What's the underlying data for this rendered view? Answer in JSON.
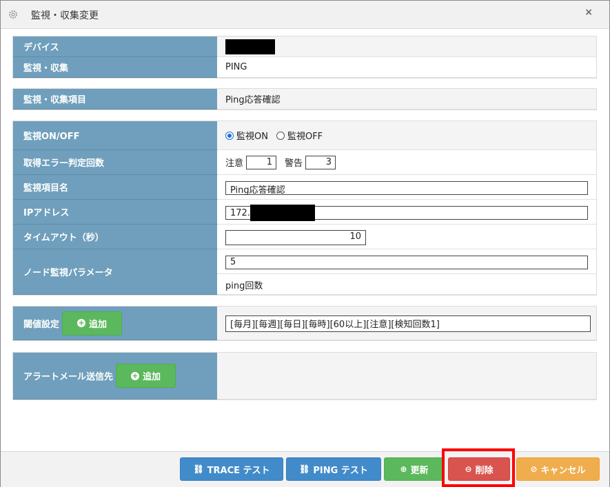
{
  "dialog": {
    "title": "監視・収集変更",
    "close_label": "×",
    "title_icon": "gear-icon"
  },
  "section1": {
    "device_label": "デバイス",
    "device_value": "",
    "monitor_label": "監視・収集",
    "monitor_value": "PING"
  },
  "section2": {
    "item_label": "監視・収集項目",
    "item_value": "Ping応答確認"
  },
  "section3": {
    "onoff_label": "監視ON/OFF",
    "on_label": "監視ON",
    "off_label": "監視OFF",
    "on_selected": true,
    "error_label": "取得エラー判定回数",
    "caution_label": "注意",
    "caution_value": "1",
    "warning_label": "警告",
    "warning_value": "3",
    "name_label": "監視項目名",
    "name_value": "Ping応答確認",
    "ip_label": "IPアドレス",
    "ip_value": "172.",
    "timeout_label": "タイムアウト（秒）",
    "timeout_value": "10",
    "node_label": "ノード監視パラメータ",
    "node_value": "5",
    "node_hint": "ping回数"
  },
  "section4": {
    "threshold_label": "閾値設定",
    "add_label": "追加",
    "threshold_value": "[毎月][毎週][毎日][毎時][60以上][注意][検知回数1]"
  },
  "section5": {
    "alert_label": "アラートメール送信先",
    "add_label": "追加"
  },
  "footer": {
    "trace_label": "TRACE テスト",
    "ping_label": "PING テスト",
    "update_label": "更新",
    "delete_label": "削除",
    "cancel_label": "キャンセル"
  },
  "colors": {
    "label_bg": "#6f9fbc",
    "button_blue": "#428bca",
    "button_green": "#5cb85c",
    "button_red": "#d9534f",
    "button_orange": "#f0ad4e",
    "highlight": "#ff0000"
  }
}
